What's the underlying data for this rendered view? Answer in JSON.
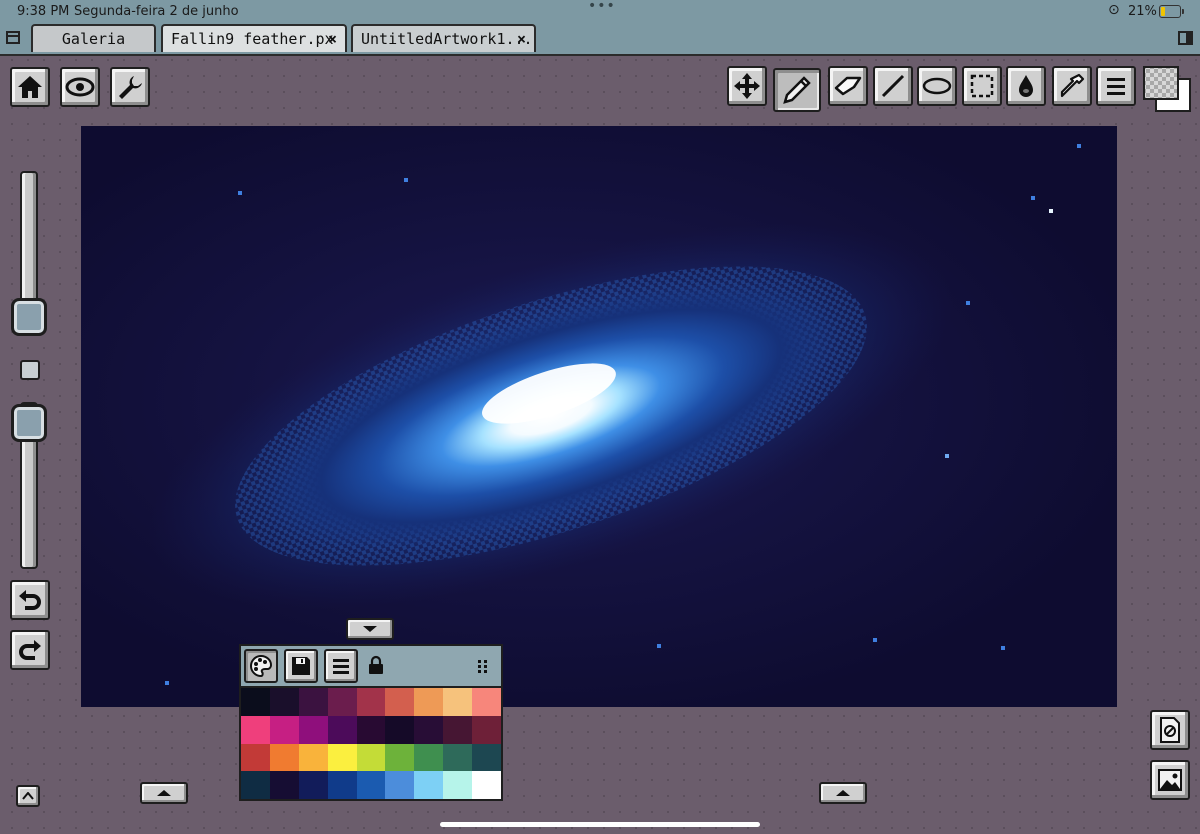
{
  "status_bar": {
    "time": "9:38 PM",
    "date": "Segunda-feira 2 de junho",
    "battery_percent": "21%",
    "battery_level": 0.21
  },
  "tabs": [
    {
      "label": "Galeria"
    },
    {
      "label": "Fallin9 feather.px"
    },
    {
      "label": "UntitledArtwork1..."
    }
  ],
  "tab_close_glyph": "×",
  "top_left_tools": [
    {
      "icon": "home-icon"
    },
    {
      "icon": "eye-icon"
    },
    {
      "icon": "wrench-icon"
    }
  ],
  "top_right_tools": [
    {
      "icon": "move-icon"
    },
    {
      "icon": "pencil-icon",
      "active": true
    },
    {
      "icon": "eraser-icon"
    },
    {
      "icon": "line-icon"
    },
    {
      "icon": "ellipse-icon"
    },
    {
      "icon": "selection-icon"
    },
    {
      "icon": "fill-bucket-icon"
    },
    {
      "icon": "eyedropper-icon"
    },
    {
      "icon": "menu-icon"
    },
    {
      "icon": "layers-color-icon"
    }
  ],
  "left_panel": {
    "brush_size_level": 0.4,
    "opacity_level": 0.0,
    "undo_icon": "undo-icon",
    "redo_icon": "redo-icon"
  },
  "palette": {
    "header_icons": [
      "palette-icon",
      "save-icon",
      "menu-icon",
      "lock-icon",
      "grip-icon"
    ],
    "colors": [
      "#0b0d1c",
      "#1a0f2b",
      "#3b1240",
      "#6b1d4d",
      "#a2334a",
      "#d35f4e",
      "#ee9a56",
      "#f6c27c",
      "#f7867b",
      "#ef3f7c",
      "#c61f83",
      "#8f0f7c",
      "#4c0b5a",
      "#280a32",
      "#150a28",
      "#280d36",
      "#461633",
      "#6e2038",
      "#c23a37",
      "#f07b30",
      "#f9b33b",
      "#fbef3f",
      "#c4dc37",
      "#6db23a",
      "#3f8f4f",
      "#2e6a5a",
      "#1d4751",
      "#0f2c43",
      "#160d33",
      "#121c5a",
      "#103b8a",
      "#1b5bb0",
      "#4c8ddb",
      "#7dd0f5",
      "#b6f4ea",
      "#ffffff"
    ]
  },
  "bottom_right_tools": [
    {
      "icon": "reference-icon"
    },
    {
      "icon": "image-icon"
    }
  ]
}
